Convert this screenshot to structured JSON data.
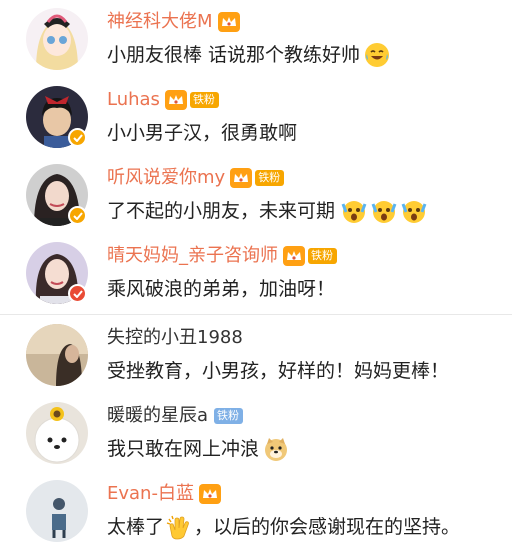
{
  "comments": [
    {
      "user": "神经科大佬M",
      "text": "小朋友很棒 话说那个教练好帅",
      "badge_text": ""
    },
    {
      "user": "Luhas",
      "text": "小小男子汉，很勇敢啊",
      "badge_text": "铁粉"
    },
    {
      "user": "听风说爱你my",
      "text": "了不起的小朋友，未来可期",
      "badge_text": "铁粉"
    },
    {
      "user": "晴天妈妈_亲子咨询师",
      "text": "乘风破浪的弟弟，加油呀！",
      "badge_text": "铁粉"
    },
    {
      "user": "失控的小丑1988",
      "text": "受挫教育，小男孩，好样的！妈妈更棒！",
      "badge_text": ""
    },
    {
      "user": "暖暖的星辰a",
      "text": "我只敢在网上冲浪",
      "badge_text": "铁粉"
    },
    {
      "user": "Evan-白蓝",
      "text": "太棒了",
      "text_after": "，以后的你会感谢现在的坚持。",
      "badge_text": ""
    }
  ],
  "colors": {
    "vip_name": "#eb7350",
    "plain_name": "#333333",
    "crown_badge": "#ffa013",
    "fan_badge": "#f7a600",
    "verified_gold": "#f7a600",
    "verified_red": "#e94b35"
  },
  "icons": {
    "crown": "crown-member-icon",
    "verified": "verified-check-icon",
    "laugh": "laughing-tears-emoji",
    "shock": "shocked-face-emoji",
    "doge": "doge-emoji",
    "clap": "clapping-hands-emoji"
  }
}
